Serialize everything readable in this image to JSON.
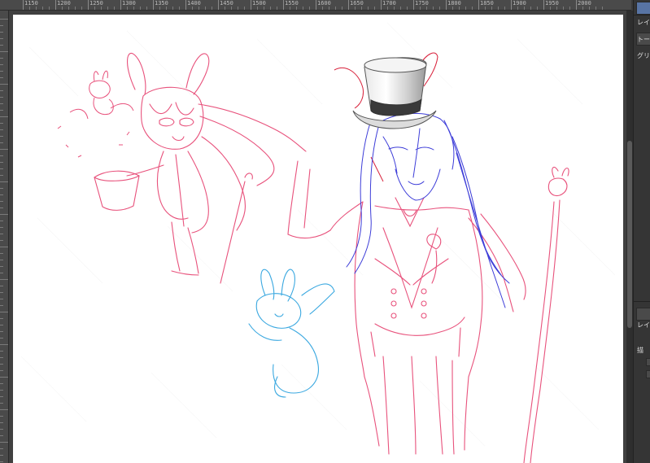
{
  "ruler_top": {
    "labels": [
      "1150",
      "1200",
      "1250",
      "1300",
      "1350",
      "1400",
      "1450",
      "1500",
      "1550",
      "1600",
      "1650",
      "1700",
      "1750",
      "1800",
      "1850",
      "1900",
      "1950",
      "2000"
    ]
  },
  "panel": {
    "tabs": [
      {
        "label": "レイ",
        "name": "layer-tab"
      },
      {
        "label": "トー",
        "name": "tone-tab"
      },
      {
        "label": "グリ",
        "name": "grid-tab"
      }
    ],
    "lower_tab": "レイ",
    "lower_text": "描"
  },
  "colors": {
    "sketch_red": "#e8527c",
    "sketch_dark_red": "#d8203a",
    "sketch_blue": "#3c3cd8",
    "sketch_cyan": "#3aa8e0",
    "hat_gray": "#555555",
    "canvas_bg": "#ffffff",
    "ui_dark": "#3b3b3b",
    "accent": "#5874a4"
  }
}
